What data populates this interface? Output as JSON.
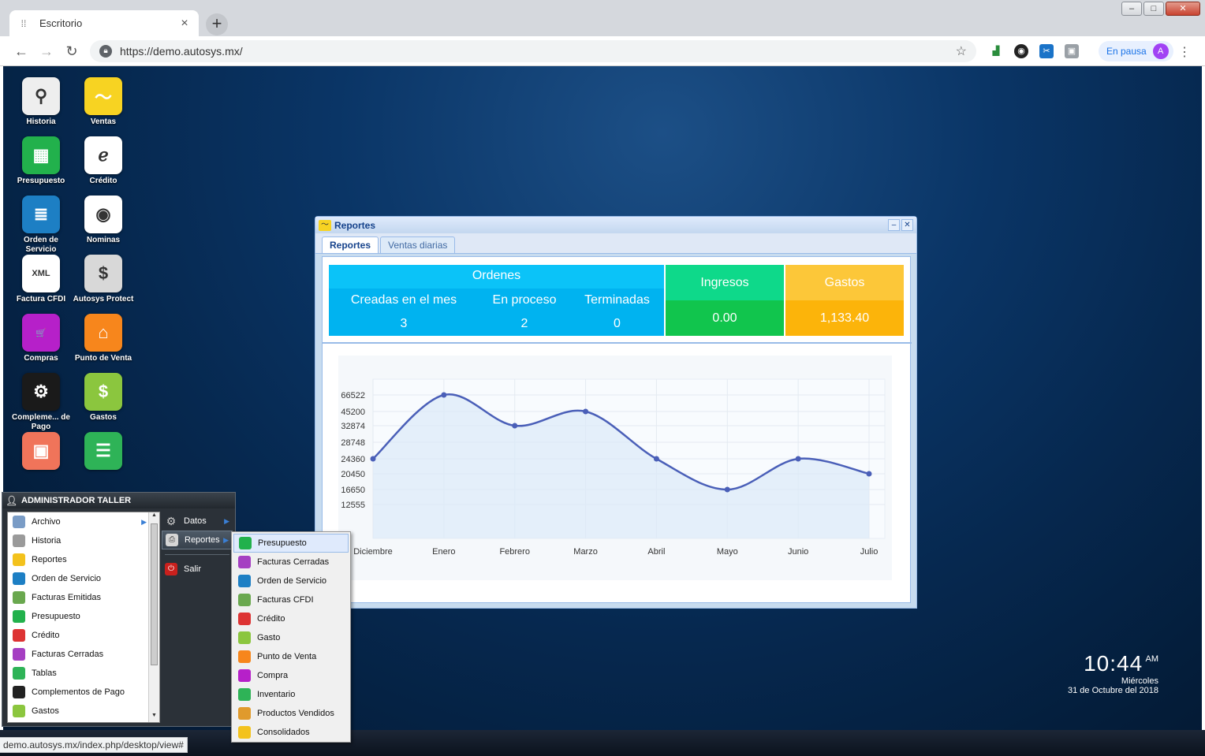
{
  "browser": {
    "tab_title": "Escritorio",
    "tab_close": "×",
    "new_tab": "+",
    "url": "https://demo.autosys.mx/",
    "profile_status": "En pausa",
    "profile_initial": "A",
    "status_url": "demo.autosys.mx/index.php/desktop/view#"
  },
  "desktop_icons": [
    {
      "label": "Historia",
      "color": "#eeeeee",
      "glyph": "⚲"
    },
    {
      "label": "Ventas",
      "color": "#f7d322",
      "glyph": "〜"
    },
    {
      "label": "Presupuesto",
      "color": "#22b14c",
      "glyph": "▦"
    },
    {
      "label": "Crédito",
      "color": "#ffffff",
      "glyph": "ℯ"
    },
    {
      "label": "Orden de Servicio",
      "color": "#1d7fc4",
      "glyph": "≣"
    },
    {
      "label": "Nominas",
      "color": "#ffffff",
      "glyph": "◉"
    },
    {
      "label": "Factura CFDI",
      "color": "#ffffff",
      "glyph": "XML"
    },
    {
      "label": "Autosys Protect",
      "color": "#d8d8d8",
      "glyph": "$"
    },
    {
      "label": "Compras",
      "color": "#b620c9",
      "glyph": "🛒"
    },
    {
      "label": "Punto de Venta",
      "color": "#f7861c",
      "glyph": "⌂"
    },
    {
      "label": "Compleme... de Pago",
      "color": "#1a1a1a",
      "glyph": "⚙"
    },
    {
      "label": "Gastos",
      "color": "#8bc63e",
      "glyph": "$"
    },
    {
      "label": "",
      "color": "#f0745a",
      "glyph": "▣"
    },
    {
      "label": "",
      "color": "#2eb357",
      "glyph": "☰"
    }
  ],
  "clock": {
    "time": "10:44",
    "ampm": "AM",
    "day": "Miércoles",
    "date": "31 de Octubre del 2018"
  },
  "window": {
    "title": "Reportes",
    "tabs": [
      "Reportes",
      "Ventas diarias"
    ],
    "ordenes": {
      "title": "Ordenes",
      "cols": [
        {
          "label": "Creadas en el mes",
          "value": "3"
        },
        {
          "label": "En proceso",
          "value": "2"
        },
        {
          "label": "Terminadas",
          "value": "0"
        }
      ]
    },
    "ingresos": {
      "label": "Ingresos",
      "value": "0.00"
    },
    "gastos": {
      "label": "Gastos",
      "value": "1,133.40"
    }
  },
  "chart_data": {
    "type": "area",
    "categories": [
      "Diciembre",
      "Enero",
      "Febrero",
      "Marzo",
      "Abril",
      "Mayo",
      "Junio",
      "Julio"
    ],
    "series": [
      {
        "values": [
          24360,
          66522,
          32874,
          45200,
          24360,
          16650,
          24360,
          20450
        ]
      }
    ],
    "y_ticks": [
      66522,
      45200,
      32874,
      28748,
      24360,
      20450,
      16650,
      12555
    ],
    "y_tick_labels": [
      "66522",
      "45200",
      "32874",
      "28748",
      "24360",
      "20450",
      "16650",
      "12555"
    ],
    "grid": true,
    "colors": {
      "line": "#4a5fb8",
      "fill": "#dceaf8"
    }
  },
  "start_menu": {
    "user": "ADMINISTRADOR TALLER",
    "items": [
      {
        "label": "Archivo",
        "color": "#7a9cc6",
        "submenu": true
      },
      {
        "label": "Historia",
        "color": "#9a9a9a"
      },
      {
        "label": "Reportes",
        "color": "#f3c21d"
      },
      {
        "label": "Orden de Servicio",
        "color": "#1d7fc4"
      },
      {
        "label": "Facturas Emitidas",
        "color": "#6aa84f"
      },
      {
        "label": "Presupuesto",
        "color": "#22b14c"
      },
      {
        "label": "Crédito",
        "color": "#d33"
      },
      {
        "label": "Facturas Cerradas",
        "color": "#a53fc2"
      },
      {
        "label": "Tablas",
        "color": "#2eb357"
      },
      {
        "label": "Complementos de Pago",
        "color": "#222222"
      },
      {
        "label": "Gastos",
        "color": "#8bc63e"
      }
    ],
    "right_items": [
      {
        "label": "Datos",
        "icon": "gear"
      },
      {
        "label": "Reportes",
        "icon": "printer"
      },
      {
        "label": "Salir",
        "icon": "power"
      }
    ]
  },
  "submenu": {
    "items": [
      {
        "label": "Presupuesto",
        "color": "#22b14c"
      },
      {
        "label": "Facturas Cerradas",
        "color": "#a53fc2"
      },
      {
        "label": "Orden de Servicio",
        "color": "#1d7fc4"
      },
      {
        "label": "Facturas CFDI",
        "color": "#6aa84f"
      },
      {
        "label": "Crédito",
        "color": "#d33"
      },
      {
        "label": "Gasto",
        "color": "#8bc63e"
      },
      {
        "label": "Punto de Venta",
        "color": "#f7861c"
      },
      {
        "label": "Compra",
        "color": "#b620c9"
      },
      {
        "label": "Inventario",
        "color": "#2eb357"
      },
      {
        "label": "Productos Vendidos",
        "color": "#e09a2c"
      },
      {
        "label": "Consolidados",
        "color": "#f3c21d"
      }
    ]
  }
}
